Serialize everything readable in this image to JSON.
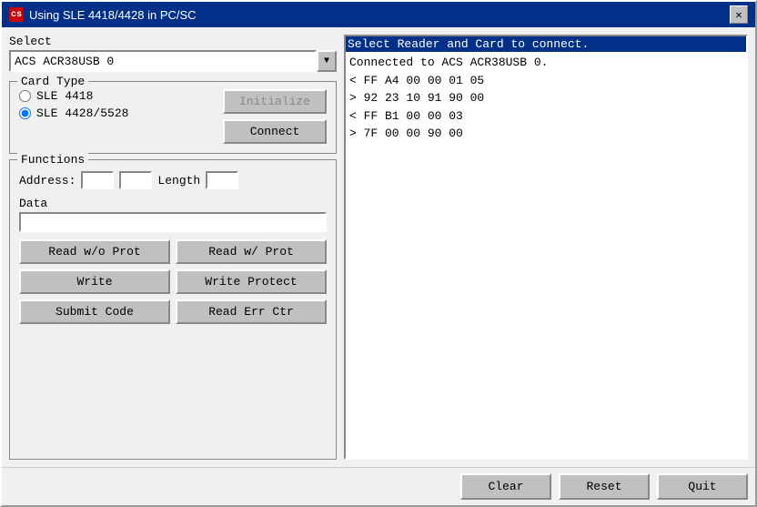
{
  "window": {
    "title": "Using SLE 4418/4428 in PC/SC",
    "icon_label": "cs"
  },
  "select": {
    "label": "Select",
    "dropdown_value": "ACS ACR38USB 0"
  },
  "card_type": {
    "legend": "Card Type",
    "options": [
      {
        "label": "SLE 4418",
        "checked": false
      },
      {
        "label": "SLE 4428/5528",
        "checked": true
      }
    ],
    "initialize_label": "Initialize",
    "connect_label": "Connect"
  },
  "functions": {
    "legend": "Functions",
    "address_label": "Address:",
    "length_label": "Length",
    "data_label": "Data",
    "address_val1": "",
    "address_val2": "",
    "length_val": "",
    "data_val": "",
    "buttons": [
      {
        "label": "Read w/o Prot",
        "name": "read-wo-prot-button"
      },
      {
        "label": "Read w/ Prot",
        "name": "read-w-prot-button"
      },
      {
        "label": "Write",
        "name": "write-button"
      },
      {
        "label": "Write Protect",
        "name": "write-protect-button"
      },
      {
        "label": "Submit Code",
        "name": "submit-code-button"
      },
      {
        "label": "Read Err Ctr",
        "name": "read-err-ctr-button"
      }
    ]
  },
  "log": {
    "header": "Select Reader and Card to connect.",
    "lines": [
      "Connected to ACS ACR38USB 0.",
      "< FF A4 00 00 01 05",
      "> 92 23 10 91 90 00",
      "< FF B1 00 00 03",
      "> 7F 00 00 90 00"
    ]
  },
  "bottom_bar": {
    "clear_label": "Clear",
    "reset_label": "Reset",
    "quit_label": "Quit"
  }
}
